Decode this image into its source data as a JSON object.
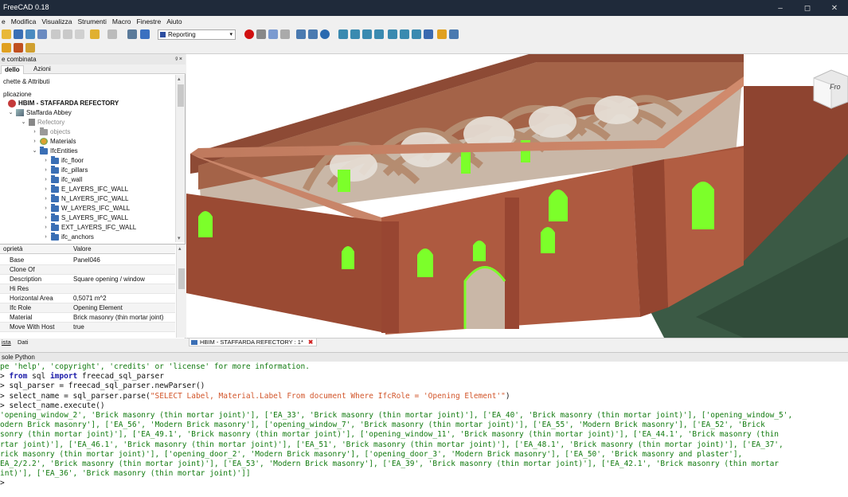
{
  "window": {
    "title": "FreeCAD 0.18",
    "controls": [
      "–",
      "◻",
      "✕"
    ]
  },
  "menu": [
    "e",
    "Modifica",
    "Visualizza",
    "Strumenti",
    "Macro",
    "Finestre",
    "Aiuto"
  ],
  "toolbar": {
    "workbench": "Reporting"
  },
  "combo": {
    "title": "e combinata",
    "tabs": [
      "dello",
      "Azioni"
    ],
    "labels_section": "chette & Attributi",
    "app_section": "plicazione"
  },
  "tree": {
    "document": "HBIM - STAFFARDA REFECTORY",
    "abbey": "Staffarda Abbey",
    "refectory": "Refectory",
    "objects": "objects",
    "materials": "Materials",
    "ifcentities": "IfcEntities",
    "entities": [
      "ifc_floor",
      "ifc_pillars",
      "ifc_wall",
      "E_LAYERS_IFC_WALL",
      "N_LAYERS_IFC_WALL",
      "W_LAYERS_IFC_WALL",
      "S_LAYERS_IFC_WALL",
      "EXT_LAYERS_IFC_WALL",
      "ifc_anchors"
    ]
  },
  "properties": {
    "col_prop": "oprietà",
    "col_val": "Valore",
    "rows": [
      {
        "k": "Base",
        "v": "Panel046"
      },
      {
        "k": "Clone Of",
        "v": ""
      },
      {
        "k": "Description",
        "v": "Square opening / window"
      },
      {
        "k": "Hi Res",
        "v": ""
      },
      {
        "k": "Horizontal Area",
        "v": "0,5071 m^2"
      },
      {
        "k": "Ifc Role",
        "v": "Opening Element"
      },
      {
        "k": "Material",
        "v": "Brick masonry (thin mortar joint)"
      },
      {
        "k": "Move With Host",
        "v": "true"
      }
    ],
    "bottom_tabs": [
      "ista",
      "Dati"
    ]
  },
  "viewport": {
    "tab": "HBIM - STAFFARDA REFECTORY : 1*",
    "navcube_label": "Fro",
    "colors": {
      "wall": "#a9543c",
      "wall_top": "#c27a60",
      "opening": "#7cff2a",
      "ground": "#3b5a45",
      "arch": "#b58c70"
    }
  },
  "console": {
    "title": "sole Python",
    "lines": [
      {
        "type": "out",
        "text": "pe 'help', 'copyright', 'credits' or 'license' for more information."
      },
      {
        "type": "in",
        "prompt": "> ",
        "kw": "from",
        "a": " sql ",
        "kw2": "import",
        "b": " freecad_sql_parser"
      },
      {
        "type": "plain",
        "text": "> sql_parser = freecad_sql_parser.newParser()"
      },
      {
        "type": "str",
        "pre": "> select_name = sql_parser.parse(",
        "s": "\"SELECT Label, Material.Label From document Where IfcRole = 'Opening Element'\"",
        "post": ")"
      },
      {
        "type": "plain",
        "text": "> select_name.execute()"
      },
      {
        "type": "res",
        "text": "'opening_window_2', 'Brick masonry (thin mortar joint)'], ['EA_33', 'Brick masonry (thin mortar joint)'], ['EA_40', 'Brick masonry (thin mortar joint)'], ['opening_window_5',"
      },
      {
        "type": "res",
        "text": "odern Brick masonry'], ['EA_56', 'Modern Brick masonry'], ['opening_window_7', 'Brick masonry (thin mortar joint)'], ['EA_55', 'Modern Brick masonry'], ['EA_52', 'Brick"
      },
      {
        "type": "res",
        "text": "sonry (thin mortar joint)'], ['EA_49.1', 'Brick masonry (thin mortar joint)'], ['opening_window_11', 'Brick masonry (thin mortar joint)'], ['EA_44.1', 'Brick masonry (thin"
      },
      {
        "type": "res",
        "text": "rtar joint)'], ['EA_46.1', 'Brick masonry (thin mortar joint)'], ['EA_51', 'Brick masonry (thin mortar joint)'], ['EA_48.1', 'Brick masonry (thin mortar joint)'], ['EA_37',"
      },
      {
        "type": "res",
        "text": "rick masonry (thin mortar joint)'], ['opening_door_2', 'Modern Brick masonry'], ['opening_door_3', 'Modern Brick masonry'], ['EA_50', 'Brick masonry and plaster'],"
      },
      {
        "type": "res",
        "text": "EA_2/2.2', 'Brick masonry (thin mortar joint)'], ['EA_53', 'Modern Brick masonry'], ['EA_39', 'Brick masonry (thin mortar joint)'], ['EA_42.1', 'Brick masonry (thin mortar"
      },
      {
        "type": "res",
        "text": "int)'], ['EA_36', 'Brick masonry (thin mortar joint)']]"
      },
      {
        "type": "plain",
        "text": ">"
      }
    ]
  }
}
